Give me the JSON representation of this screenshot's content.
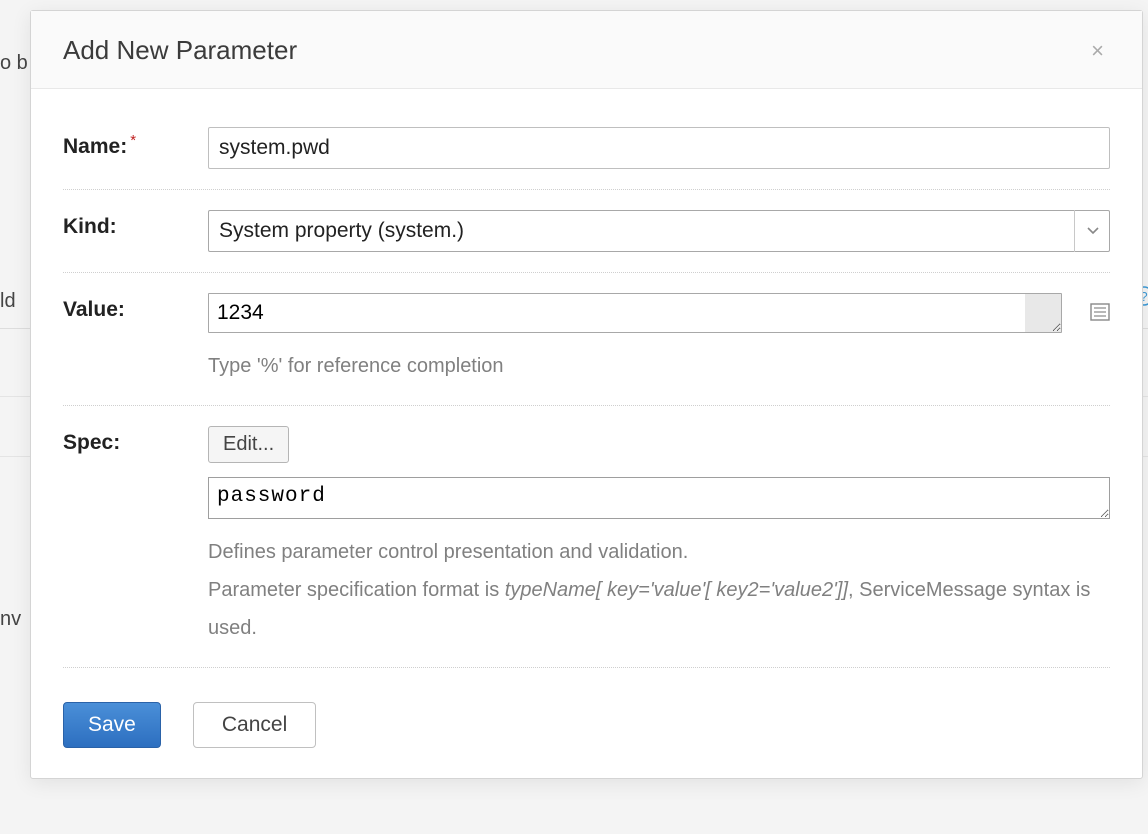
{
  "background": {
    "frag1": "o b",
    "frag2": "ld",
    "frag3": "nv"
  },
  "modal": {
    "title": "Add New Parameter",
    "close_label": "×"
  },
  "form": {
    "name": {
      "label": "Name:",
      "value": "system.pwd"
    },
    "kind": {
      "label": "Kind:",
      "selected": "System property (system.)"
    },
    "value": {
      "label": "Value:",
      "value": "1234",
      "hint": "Type '%' for reference completion"
    },
    "spec": {
      "label": "Spec:",
      "edit_button": "Edit...",
      "value": "password",
      "desc_line1": "Defines parameter control presentation and validation.",
      "desc_prefix": "Parameter specification format is ",
      "desc_format": "typeName[ key='value'[ key2='value2']]",
      "desc_suffix": ", ServiceMessage syntax is used."
    }
  },
  "footer": {
    "save": "Save",
    "cancel": "Cancel"
  }
}
